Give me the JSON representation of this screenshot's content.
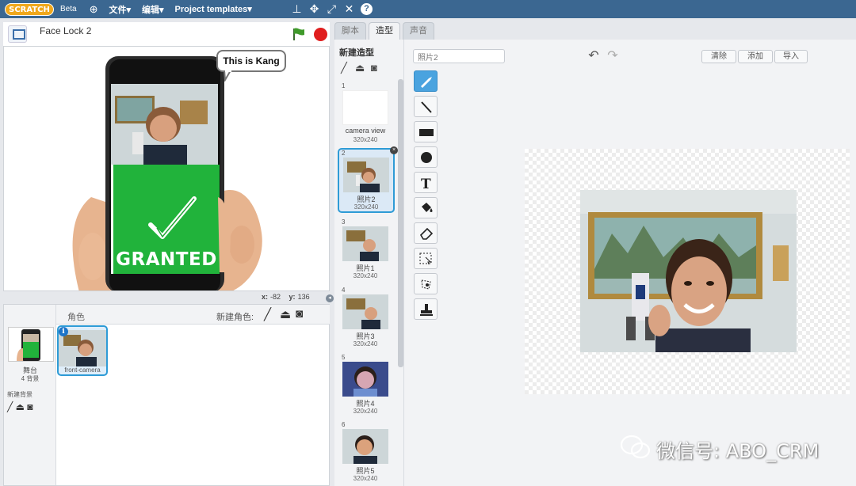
{
  "topbar": {
    "logo_text": "SCRATCH",
    "beta_label": "Beta",
    "menu": [
      "文件▾",
      "编辑▾",
      "Project templates▾"
    ],
    "icons": [
      "globe-icon",
      "stamp-icon",
      "grow-icon",
      "shrink-icon",
      "expand-icon",
      "help-icon"
    ]
  },
  "stage": {
    "project_title": "Face Lock 2",
    "speech_bubble": "This is Kang",
    "granted_text": "GRANTED",
    "coords": {
      "x_label": "x:",
      "x_value": "-82",
      "y_label": "y:",
      "y_value": "136"
    }
  },
  "sprites": {
    "header_label": "角色",
    "new_sprite_label": "新建角色:",
    "stage_label": "舞台",
    "stage_backdrops": "4 背景",
    "new_backdrop_label": "新建背景",
    "items": [
      {
        "name": "front-camera"
      }
    ]
  },
  "tabs": [
    {
      "label": "脚本",
      "active": false
    },
    {
      "label": "造型",
      "active": true
    },
    {
      "label": "声音",
      "active": false
    }
  ],
  "costumes": {
    "new_costume_label": "新建造型",
    "items": [
      {
        "index": "1",
        "name": "camera view",
        "size": "320x240",
        "selected": false
      },
      {
        "index": "2",
        "name": "照片2",
        "size": "320x240",
        "selected": true
      },
      {
        "index": "3",
        "name": "照片1",
        "size": "320x240",
        "selected": false
      },
      {
        "index": "4",
        "name": "照片3",
        "size": "320x240",
        "selected": false
      },
      {
        "index": "5",
        "name": "照片4",
        "size": "320x240",
        "selected": false
      },
      {
        "index": "6",
        "name": "照片5",
        "size": "320x240",
        "selected": false
      }
    ]
  },
  "paint_editor": {
    "costume_name": "照片2",
    "clear_label": "清除",
    "add_label": "添加",
    "import_label": "导入",
    "tools": [
      "brush-icon",
      "line-icon",
      "rectangle-icon",
      "ellipse-icon",
      "text-icon",
      "fill-icon",
      "eraser-icon",
      "select-icon",
      "reshape-icon",
      "stamp-icon"
    ]
  },
  "watermark": "微信号: ABO_CRM",
  "colors": {
    "topbar": "#3b6791",
    "accent": "#2e9bd6",
    "granted_green": "#21b33b"
  }
}
